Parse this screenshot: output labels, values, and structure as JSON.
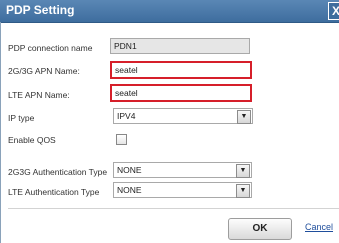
{
  "dialog": {
    "title": "PDP Setting",
    "close_label": "X"
  },
  "fields": {
    "pdp_connection_name": {
      "label": "PDP connection name",
      "value": "PDN1"
    },
    "apn_2g3g": {
      "label": "2G/3G APN Name:",
      "value": "seatel"
    },
    "apn_lte": {
      "label": "LTE APN Name:",
      "value": "seatel"
    },
    "ip_type": {
      "label": "IP type",
      "value": "IPV4"
    },
    "enable_qos": {
      "label": "Enable QOS",
      "checked": false
    },
    "auth_2g3g": {
      "label": "2G3G Authentication Type",
      "value": "NONE"
    },
    "auth_lte": {
      "label": "LTE Authentication Type",
      "value": "NONE"
    }
  },
  "buttons": {
    "ok": "OK",
    "cancel": "Cancel"
  },
  "colors": {
    "highlight_border": "#d61f2a",
    "titlebar": "#4a79a9"
  }
}
